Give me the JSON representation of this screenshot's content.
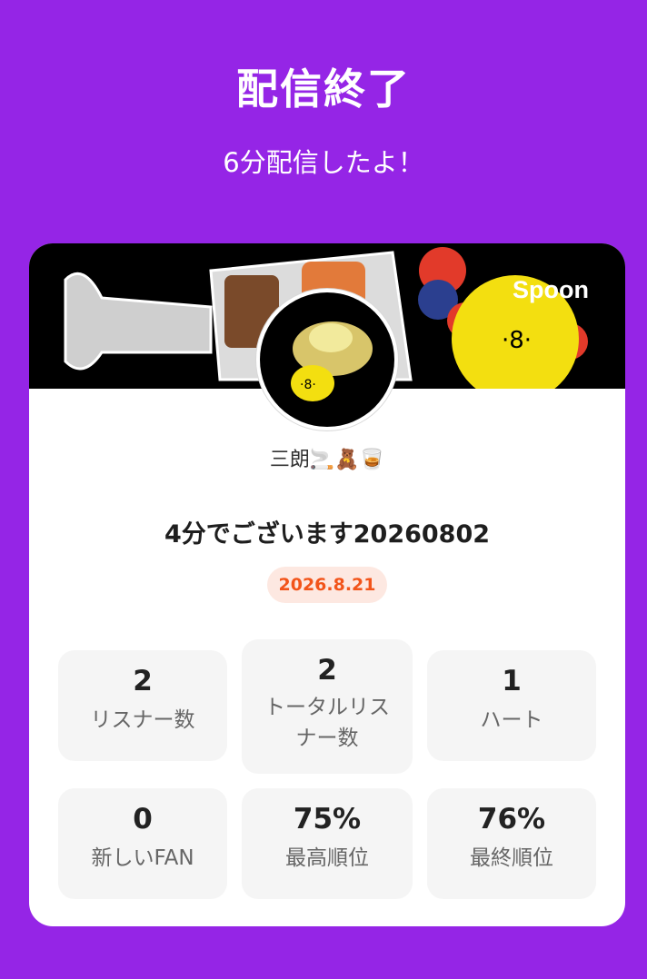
{
  "header": {
    "title": "配信終了",
    "subtitle": "6分配信したよ！"
  },
  "card": {
    "brand": "Spoon",
    "username": "三朗🚬🧸🥃",
    "stream_title": "4分でございます20260802",
    "date": "2026.8.21"
  },
  "stats": [
    {
      "value": "2",
      "label": "リスナー数"
    },
    {
      "value": "2",
      "label": "トータルリスナー数"
    },
    {
      "value": "1",
      "label": "ハート"
    },
    {
      "value": "0",
      "label": "新しいFAN"
    },
    {
      "value": "75%",
      "label": "最高順位"
    },
    {
      "value": "76%",
      "label": "最終順位"
    }
  ],
  "colors": {
    "background": "#9525e6",
    "date_text": "#f2541a",
    "date_bg": "#fde8e1"
  }
}
